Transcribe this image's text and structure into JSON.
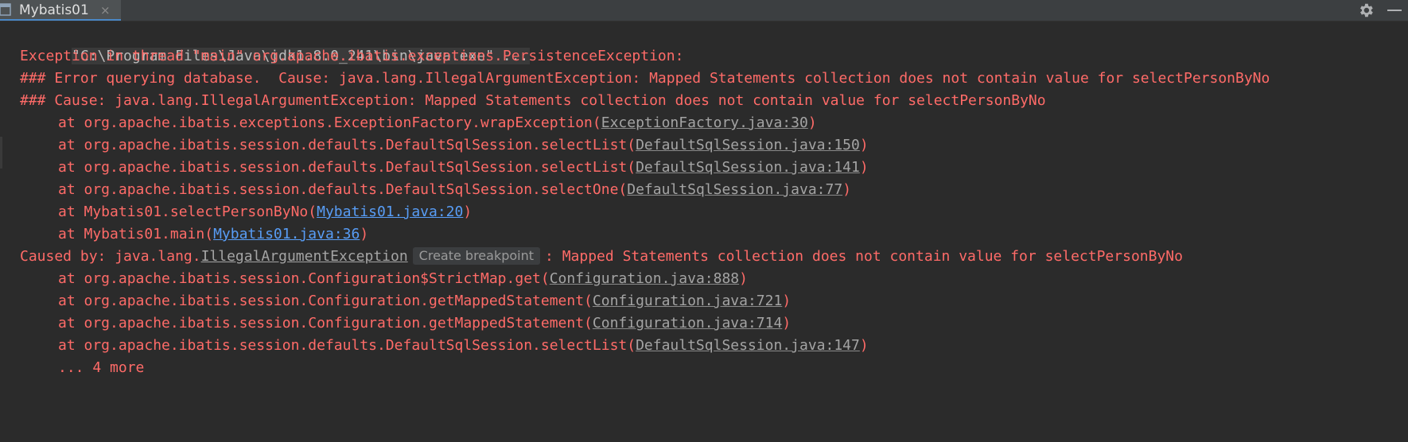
{
  "tab": {
    "title": "Mybatis01",
    "close_glyph": "×"
  },
  "icons": {
    "tab": "console-icon",
    "settings": "gear-icon",
    "minimize": "minimize-icon"
  },
  "colors": {
    "error_text": "#ff6b68",
    "command_text": "#bbbbbb",
    "link_gray": "#a4a4a4",
    "link_blue": "#589df6",
    "background": "#2b2b2b"
  },
  "console": {
    "command": "\"C:\\Program Files\\Java\\jdk1.8.0_241\\bin\\java.exe\" ...",
    "exception_line": "Exception in thread \"main\" org.apache.ibatis.exceptions.PersistenceException:",
    "error_querying": "### Error querying database.  Cause: java.lang.IllegalArgumentException: Mapped Statements collection does not contain value for selectPersonByNo",
    "cause_line": "### Cause: java.lang.IllegalArgumentException: Mapped Statements collection does not contain value for selectPersonByNo",
    "frames1": [
      {
        "prefix": "at org.apache.ibatis.exceptions.ExceptionFactory.wrapException(",
        "link": "ExceptionFactory.java:30",
        "suffix": ")"
      },
      {
        "prefix": "at org.apache.ibatis.session.defaults.DefaultSqlSession.selectList(",
        "link": "DefaultSqlSession.java:150",
        "suffix": ")"
      },
      {
        "prefix": "at org.apache.ibatis.session.defaults.DefaultSqlSession.selectList(",
        "link": "DefaultSqlSession.java:141",
        "suffix": ")"
      },
      {
        "prefix": "at org.apache.ibatis.session.defaults.DefaultSqlSession.selectOne(",
        "link": "DefaultSqlSession.java:77",
        "suffix": ")"
      },
      {
        "prefix": "at Mybatis01.selectPersonByNo(",
        "link": "Mybatis01.java:20",
        "suffix": ")"
      },
      {
        "prefix": "at Mybatis01.main(",
        "link": "Mybatis01.java:36",
        "suffix": ")"
      }
    ],
    "caused_by": {
      "prefix": "Caused by: java.lang.",
      "class_link": "IllegalArgumentException",
      "breakpoint_hint": "Create breakpoint",
      "message": ": Mapped Statements collection does not contain value for selectPersonByNo"
    },
    "frames2": [
      {
        "prefix": "at org.apache.ibatis.session.Configuration$StrictMap.get(",
        "link": "Configuration.java:888",
        "suffix": ")"
      },
      {
        "prefix": "at org.apache.ibatis.session.Configuration.getMappedStatement(",
        "link": "Configuration.java:721",
        "suffix": ")"
      },
      {
        "prefix": "at org.apache.ibatis.session.Configuration.getMappedStatement(",
        "link": "Configuration.java:714",
        "suffix": ")"
      },
      {
        "prefix": "at org.apache.ibatis.session.defaults.DefaultSqlSession.selectList(",
        "link": "DefaultSqlSession.java:147",
        "suffix": ")"
      }
    ],
    "more": "... 4 more"
  }
}
